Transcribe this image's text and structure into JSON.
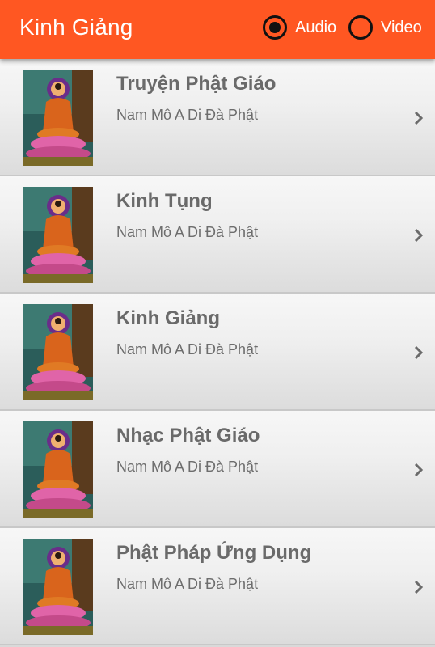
{
  "appbar": {
    "title": "Kinh Giảng",
    "color": "#ff5722",
    "options": [
      {
        "label": "Audio",
        "selected": true
      },
      {
        "label": "Video",
        "selected": false
      }
    ]
  },
  "list": {
    "items": [
      {
        "title": "Truyện Phật Giáo",
        "subtitle": "Nam Mô A Di Đà Phật",
        "icon": "buddha-image"
      },
      {
        "title": "Kinh Tụng",
        "subtitle": "Nam Mô A Di Đà Phật",
        "icon": "buddha-image"
      },
      {
        "title": "Kinh Giảng",
        "subtitle": "Nam Mô A Di Đà Phật",
        "icon": "buddha-image"
      },
      {
        "title": "Nhạc Phật Giáo",
        "subtitle": "Nam Mô A Di Đà Phật",
        "icon": "buddha-image"
      },
      {
        "title": "Phật Pháp Ứng Dụng",
        "subtitle": "Nam Mô A Di Đà Phật",
        "icon": "buddha-image"
      }
    ]
  }
}
